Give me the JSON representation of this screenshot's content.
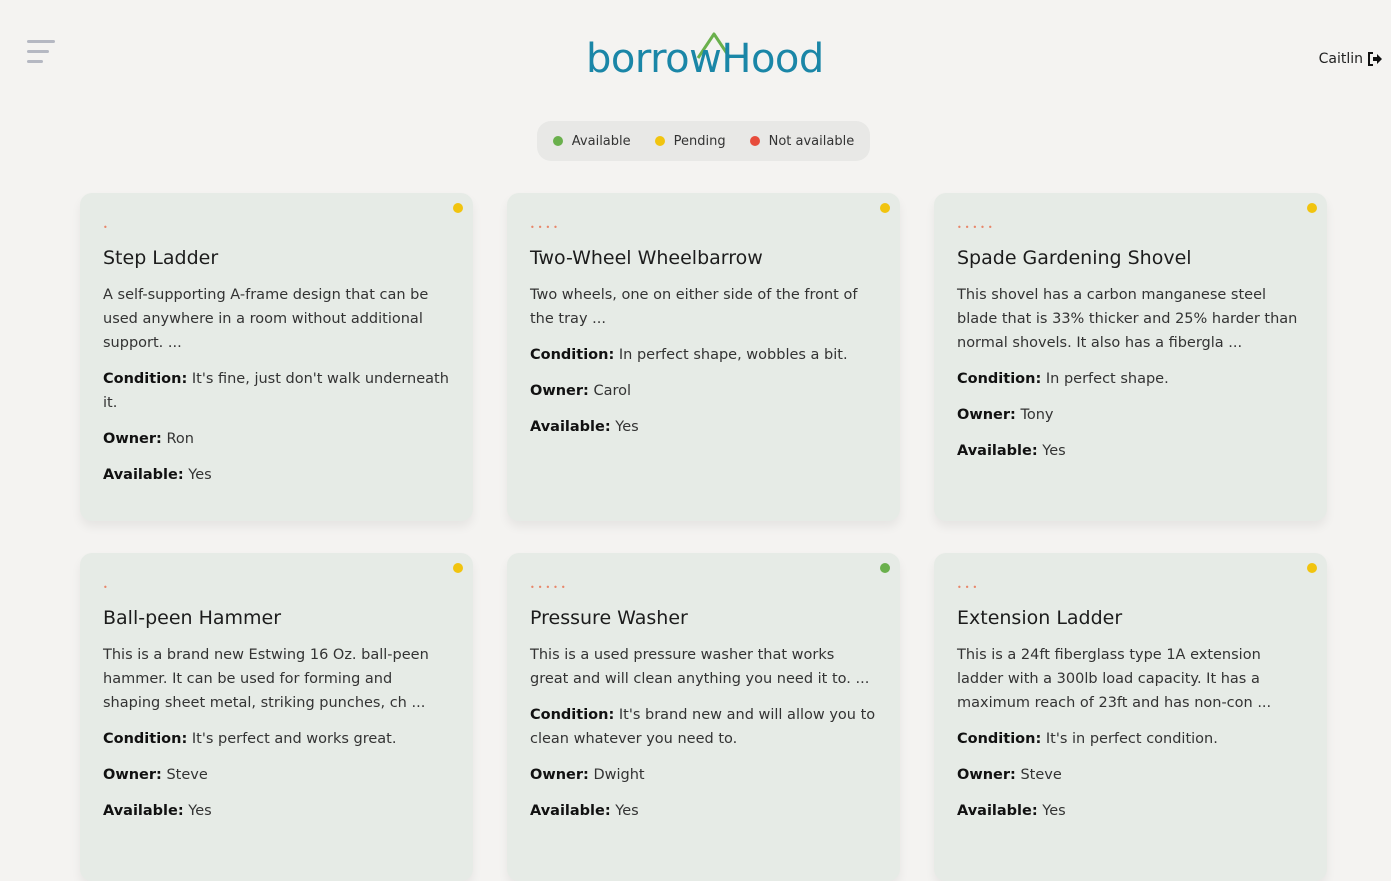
{
  "header": {
    "logo_text": "borrowHood",
    "user_name": "Caitlin"
  },
  "legend": [
    {
      "label": "Available",
      "color": "#6ab04c"
    },
    {
      "label": "Pending",
      "color": "#f1c40f"
    },
    {
      "label": "Not available",
      "color": "#e74c3c"
    }
  ],
  "labels": {
    "condition": "Condition:",
    "owner": "Owner:",
    "available": "Available:"
  },
  "cards": [
    {
      "stars": "•",
      "title": "Step Ladder",
      "description": "A self-supporting A-frame design that can be used anywhere in a room without additional support. ...",
      "condition": "It's fine, just don't walk underneath it.",
      "owner": "Ron",
      "available": "Yes",
      "status_color": "#f1c40f"
    },
    {
      "stars": "••••",
      "title": "Two-Wheel Wheelbarrow",
      "description": "Two wheels, one on either side of the front of the tray ...",
      "condition": "In perfect shape, wobbles a bit.",
      "owner": "Carol",
      "available": "Yes",
      "status_color": "#f1c40f"
    },
    {
      "stars": "•••••",
      "title": "Spade Gardening Shovel",
      "description": "This shovel has a carbon manganese steel blade that is 33% thicker and 25% harder than normal shovels. It also has a fibergla ...",
      "condition": "In perfect shape.",
      "owner": "Tony",
      "available": "Yes",
      "status_color": "#f1c40f"
    },
    {
      "stars": "•",
      "title": "Ball-peen Hammer",
      "description": "This is a brand new Estwing 16 Oz. ball-peen hammer. It can be used for forming and shaping sheet metal, striking punches, ch ...",
      "condition": "It's perfect and works great.",
      "owner": "Steve",
      "available": "Yes",
      "status_color": "#f1c40f"
    },
    {
      "stars": "•••••",
      "title": "Pressure Washer",
      "description": "This is a used pressure washer that works great and will clean anything you need it to. ...",
      "condition": "It's brand new and will allow you to clean whatever you need to.",
      "owner": "Dwight",
      "available": "Yes",
      "status_color": "#6ab04c"
    },
    {
      "stars": "•••",
      "title": "Extension Ladder",
      "description": "This is a 24ft fiberglass type 1A extension ladder with a 300lb load capacity. It has a maximum reach of 23ft and has non-con ...",
      "condition": "It's in perfect condition.",
      "owner": "Steve",
      "available": "Yes",
      "status_color": "#f1c40f"
    }
  ]
}
